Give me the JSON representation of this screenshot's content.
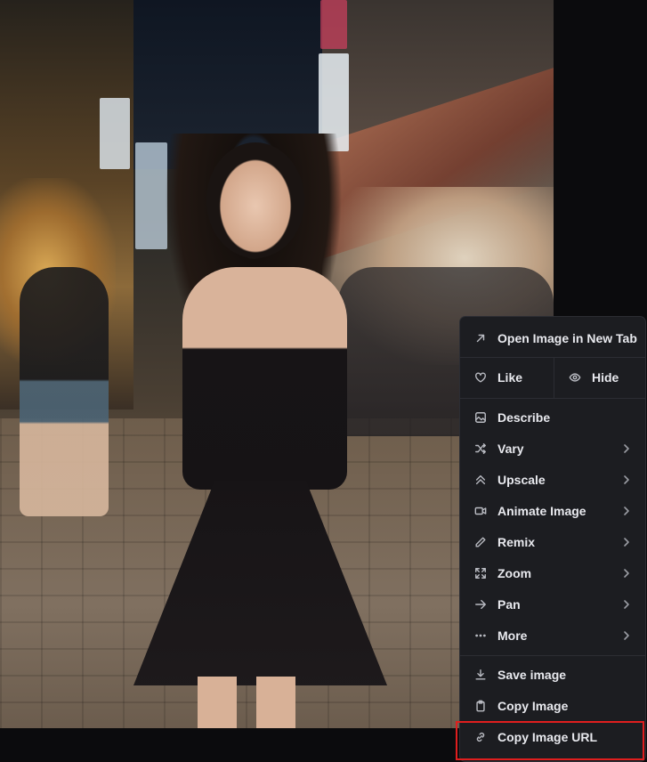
{
  "menu": {
    "open_new_tab": "Open Image in New Tab",
    "like": "Like",
    "hide": "Hide",
    "describe": "Describe",
    "vary": "Vary",
    "upscale": "Upscale",
    "animate": "Animate Image",
    "remix": "Remix",
    "zoom": "Zoom",
    "pan": "Pan",
    "more": "More",
    "save": "Save image",
    "copy_image": "Copy Image",
    "copy_url": "Copy Image URL"
  },
  "colors": {
    "menu_bg": "#1c1d21",
    "menu_border": "#2c2d33",
    "text": "#e8e9ee",
    "highlight": "#e01e1e"
  }
}
